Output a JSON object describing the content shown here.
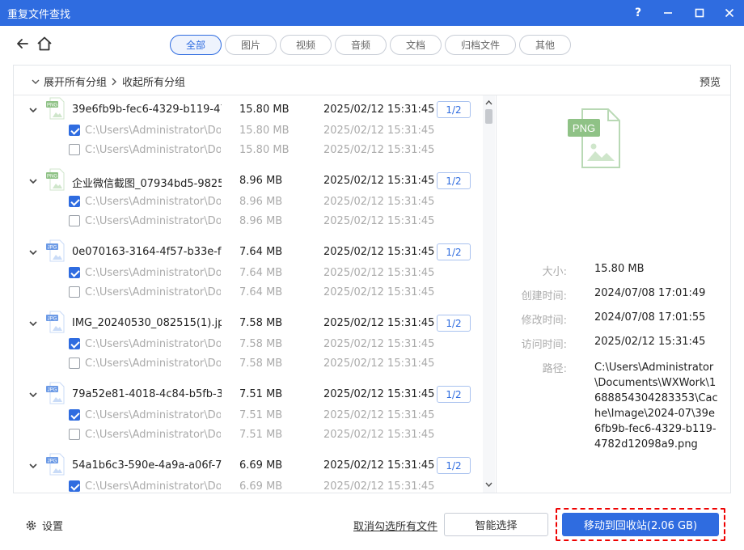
{
  "window": {
    "title": "重复文件查找",
    "help": "?",
    "min_glyph": "—",
    "max_glyph": "☐",
    "close_glyph": "✕"
  },
  "tabs": [
    "全部",
    "图片",
    "视频",
    "音频",
    "文档",
    "归档文件",
    "其他"
  ],
  "active_tab": 0,
  "toolbar": {
    "expand_all": "展开所有分组",
    "collapse_all": "收起所有分组",
    "preview": "预览"
  },
  "groups": [
    {
      "name": "39e6fb9b-fec6-4329-b119-47...",
      "size": "15.80 MB",
      "date": "2025/02/12 15:31:45",
      "count": "1/2",
      "type": "PNG",
      "files": [
        {
          "path": "C:\\Users\\Administrator\\Do...",
          "size": "15.80 MB",
          "date": "2025/02/12 15:31:45",
          "checked": true
        },
        {
          "path": "C:\\Users\\Administrator\\Do...",
          "size": "15.80 MB",
          "date": "2025/02/12 15:31:45",
          "checked": false
        }
      ]
    },
    {
      "name": "企业微信截图_07934bd5-9825-...",
      "size": "8.96 MB",
      "date": "2025/02/12 15:31:45",
      "count": "1/2",
      "type": "PNG",
      "files": [
        {
          "path": "C:\\Users\\Administrator\\Do...",
          "size": "8.96 MB",
          "date": "2025/02/12 15:31:45",
          "checked": true
        },
        {
          "path": "C:\\Users\\Administrator\\Do...",
          "size": "8.96 MB",
          "date": "2025/02/12 15:31:45",
          "checked": false
        }
      ]
    },
    {
      "name": "0e070163-3164-4f57-b33e-f2...",
      "size": "7.64 MB",
      "date": "2025/02/12 15:31:45",
      "count": "1/2",
      "type": "JPG",
      "files": [
        {
          "path": "C:\\Users\\Administrator\\Do...",
          "size": "7.64 MB",
          "date": "2025/02/12 15:31:45",
          "checked": true
        },
        {
          "path": "C:\\Users\\Administrator\\Do...",
          "size": "7.64 MB",
          "date": "2025/02/12 15:31:45",
          "checked": false
        }
      ]
    },
    {
      "name": "IMG_20240530_082515(1).jpg",
      "size": "7.58 MB",
      "date": "2025/02/12 15:31:45",
      "count": "1/2",
      "type": "JPG",
      "files": [
        {
          "path": "C:\\Users\\Administrator\\Do...",
          "size": "7.58 MB",
          "date": "2025/02/12 15:31:45",
          "checked": true
        },
        {
          "path": "C:\\Users\\Administrator\\Do...",
          "size": "7.58 MB",
          "date": "2025/02/12 15:31:45",
          "checked": false
        }
      ]
    },
    {
      "name": "79a52e81-4018-4c84-b5fb-35...",
      "size": "7.51 MB",
      "date": "2025/02/12 15:31:45",
      "count": "1/2",
      "type": "JPG",
      "files": [
        {
          "path": "C:\\Users\\Administrator\\Do...",
          "size": "7.51 MB",
          "date": "2025/02/12 15:31:45",
          "checked": true
        },
        {
          "path": "C:\\Users\\Administrator\\Do...",
          "size": "7.51 MB",
          "date": "2025/02/12 15:31:45",
          "checked": false
        }
      ]
    },
    {
      "name": "54a1b6c3-590e-4a9a-a06f-78...",
      "size": "6.69 MB",
      "date": "2025/02/12 15:31:45",
      "count": "1/2",
      "type": "JPG",
      "files": [
        {
          "path": "C:\\Users\\Administrator\\Do...",
          "size": "6.69 MB",
          "date": "2025/02/12 15:31:45",
          "checked": true
        }
      ]
    }
  ],
  "preview": {
    "type_label": "PNG",
    "size_label": "大小:",
    "size": "15.80 MB",
    "created_label": "创建时间:",
    "created": "2024/07/08 17:01:49",
    "modified_label": "修改时间:",
    "modified": "2024/07/08 17:01:55",
    "accessed_label": "访问时间:",
    "accessed": "2025/02/12 15:31:45",
    "path_label": "路径:",
    "path": "C:\\Users\\Administrator\\Documents\\WXWork\\1688854304283353\\Cache\\Image\\2024-07\\39e6fb9b-fec6-4329-b119-4782d12098a9.png"
  },
  "footer": {
    "settings": "设置",
    "deselect_all": "取消勾选所有文件",
    "smart_select": "智能选择",
    "move_to_recycle": "移动到回收站(2.06 GB)"
  },
  "colors": {
    "accent": "#2f6ce0",
    "highlight_dash": "#e00000"
  }
}
